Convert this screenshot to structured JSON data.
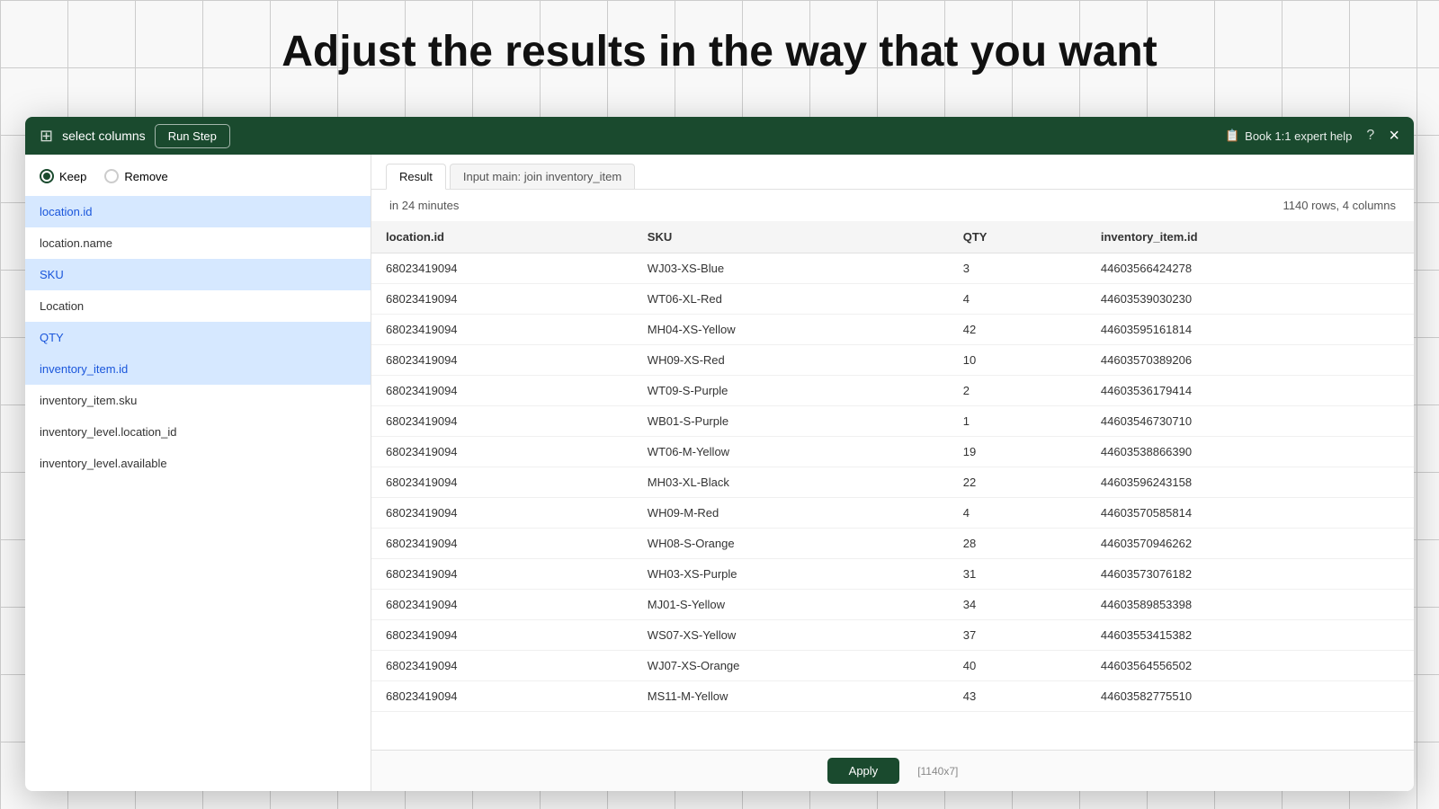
{
  "page": {
    "title": "Adjust the results in the way that you want"
  },
  "modal": {
    "header": {
      "icon": "⊞",
      "title": "select columns",
      "run_step_label": "Run Step",
      "expert_help_label": "Book 1:1 expert help",
      "close_label": "×"
    },
    "left_panel": {
      "radio_keep": "Keep",
      "radio_remove": "Remove",
      "columns": [
        {
          "id": "location.id",
          "label": "location.id",
          "selected": true
        },
        {
          "id": "location.name",
          "label": "location.name",
          "selected": false
        },
        {
          "id": "SKU",
          "label": "SKU",
          "selected": true
        },
        {
          "id": "Location",
          "label": "Location",
          "selected": false
        },
        {
          "id": "QTY",
          "label": "QTY",
          "selected": true
        },
        {
          "id": "inventory_item.id",
          "label": "inventory_item.id",
          "selected": true
        },
        {
          "id": "inventory_item.sku",
          "label": "inventory_item.sku",
          "selected": false
        },
        {
          "id": "inventory_level.location_id",
          "label": "inventory_level.location_id",
          "selected": false
        },
        {
          "id": "inventory_level.available",
          "label": "inventory_level.available",
          "selected": false
        }
      ]
    },
    "right_panel": {
      "tabs": [
        {
          "id": "result",
          "label": "Result",
          "active": true
        },
        {
          "id": "input",
          "label": "Input main: join inventory_item",
          "active": false
        }
      ],
      "result_info": {
        "time": "in 24 minutes",
        "count": "1140 rows, 4 columns"
      },
      "table": {
        "headers": [
          "location.id",
          "SKU",
          "QTY",
          "inventory_item.id"
        ],
        "rows": [
          [
            "68023419094",
            "WJ03-XS-Blue",
            "3",
            "44603566424278"
          ],
          [
            "68023419094",
            "WT06-XL-Red",
            "4",
            "44603539030230"
          ],
          [
            "68023419094",
            "MH04-XS-Yellow",
            "42",
            "44603595161814"
          ],
          [
            "68023419094",
            "WH09-XS-Red",
            "10",
            "44603570389206"
          ],
          [
            "68023419094",
            "WT09-S-Purple",
            "2",
            "44603536179414"
          ],
          [
            "68023419094",
            "WB01-S-Purple",
            "1",
            "44603546730710"
          ],
          [
            "68023419094",
            "WT06-M-Yellow",
            "19",
            "44603538866390"
          ],
          [
            "68023419094",
            "MH03-XL-Black",
            "22",
            "44603596243158"
          ],
          [
            "68023419094",
            "WH09-M-Red",
            "4",
            "44603570585814"
          ],
          [
            "68023419094",
            "WH08-S-Orange",
            "28",
            "44603570946262"
          ],
          [
            "68023419094",
            "WH03-XS-Purple",
            "31",
            "44603573076182"
          ],
          [
            "68023419094",
            "MJ01-S-Yellow",
            "34",
            "44603589853398"
          ],
          [
            "68023419094",
            "WS07-XS-Yellow",
            "37",
            "44603553415382"
          ],
          [
            "68023419094",
            "WJ07-XS-Orange",
            "40",
            "44603564556502"
          ],
          [
            "68023419094",
            "MS11-M-Yellow",
            "43",
            "44603582775510"
          ]
        ]
      }
    },
    "bottom": {
      "btn_label": "Apply",
      "info": "[1140x7]"
    }
  }
}
